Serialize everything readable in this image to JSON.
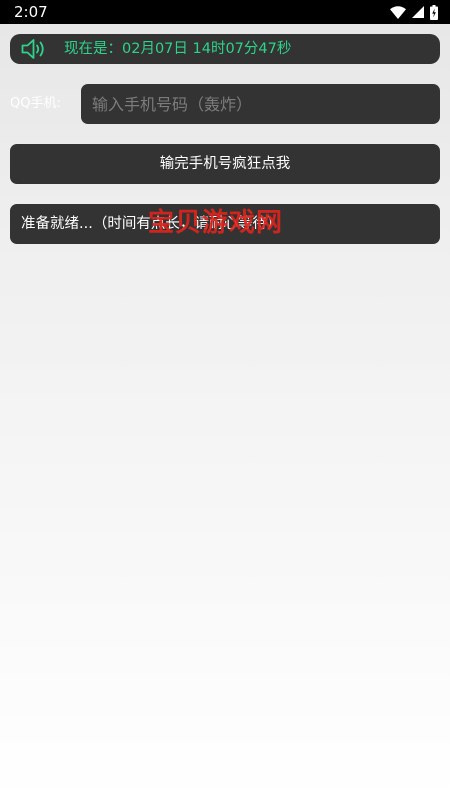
{
  "status_bar": {
    "time": "2:07",
    "icons": [
      "wifi-icon",
      "cell-signal-icon",
      "battery-charging-icon"
    ]
  },
  "time_bar": {
    "icon": "speaker-icon",
    "text": "现在是：02月07日 14时07分47秒",
    "accent_color": "#2ed38a"
  },
  "phone_form": {
    "label": "QQ手机:",
    "input_value": "",
    "input_placeholder": "输入手机号码（轰炸）"
  },
  "bomb_button": {
    "label": "输完手机号疯狂点我"
  },
  "status_message": {
    "text": "准备就绪...（时间有点长，请耐心等待）"
  },
  "watermark": {
    "text": "宝贝游戏网",
    "color": "#e0241c"
  }
}
